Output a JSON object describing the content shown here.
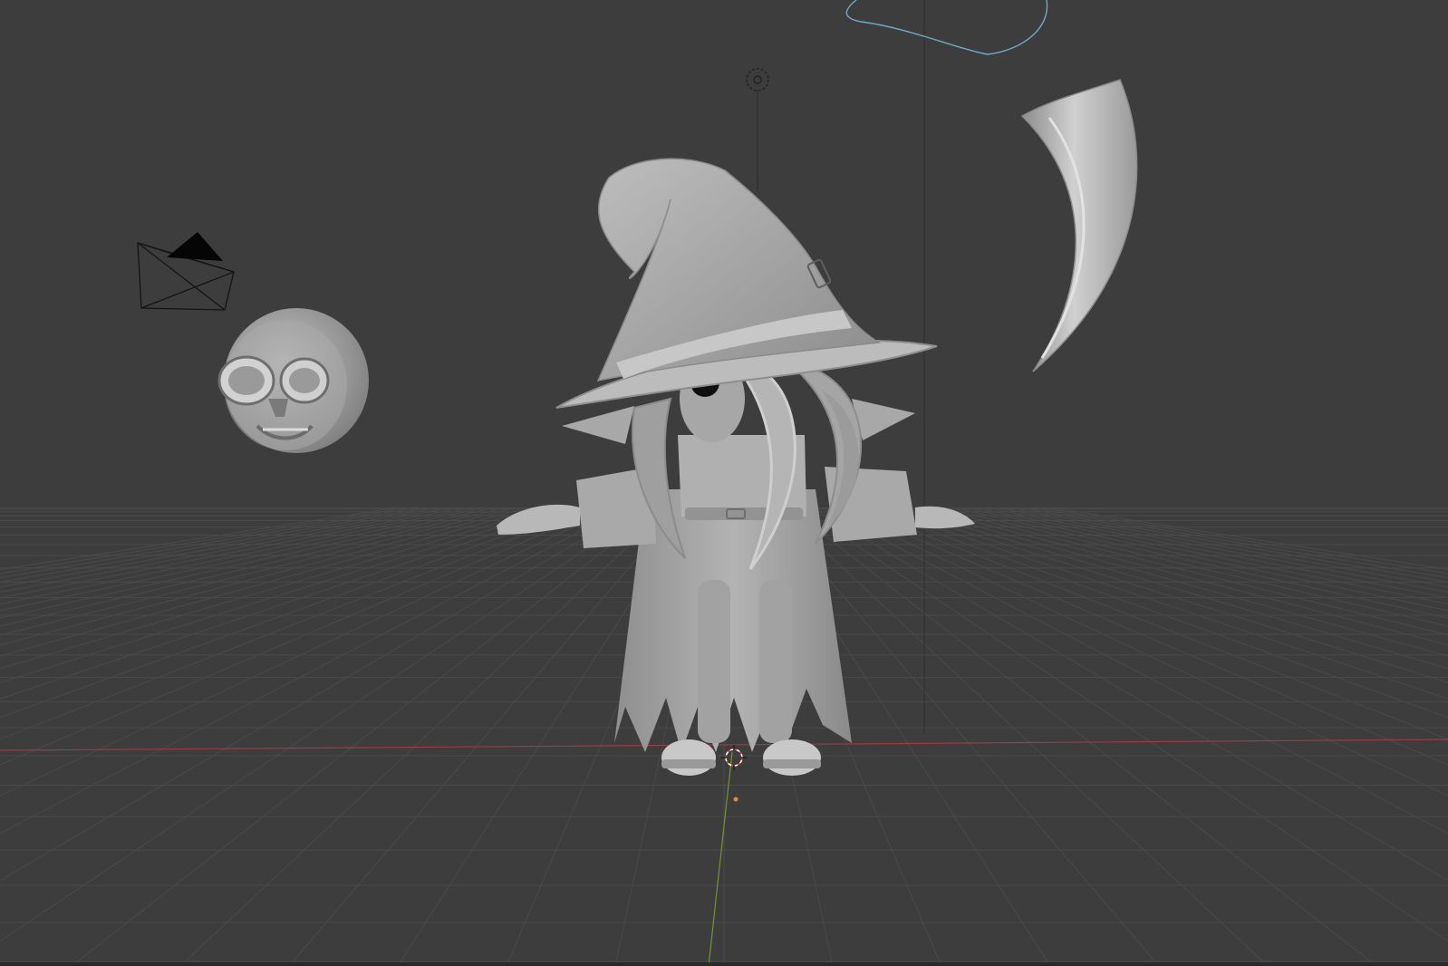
{
  "viewport": {
    "mode": "3d-viewport",
    "shading": "solid",
    "colors": {
      "background": "#3d3d3d",
      "grid": "#4a4a4a",
      "x_axis": "#9b3c47",
      "y_axis": "#6f9634",
      "mesh": "#a4a4a4",
      "mesh_shadow": "#7c7c7c",
      "mesh_highlight": "#cfcfcf",
      "light_outline": "#6fa9c4",
      "bottom_strip": "#2a2a2a"
    }
  },
  "objects": [
    {
      "name": "camera",
      "icon": "camera-icon",
      "selected": false
    },
    {
      "name": "skull-head",
      "icon": "mesh-icon",
      "selected": false
    },
    {
      "name": "witch-character",
      "icon": "mesh-icon",
      "selected": false
    },
    {
      "name": "horn-piece",
      "icon": "mesh-icon",
      "selected": false
    },
    {
      "name": "area-light",
      "icon": "light-icon",
      "selected": false
    },
    {
      "name": "light-gizmo",
      "icon": "light-icon",
      "selected": false
    }
  ]
}
